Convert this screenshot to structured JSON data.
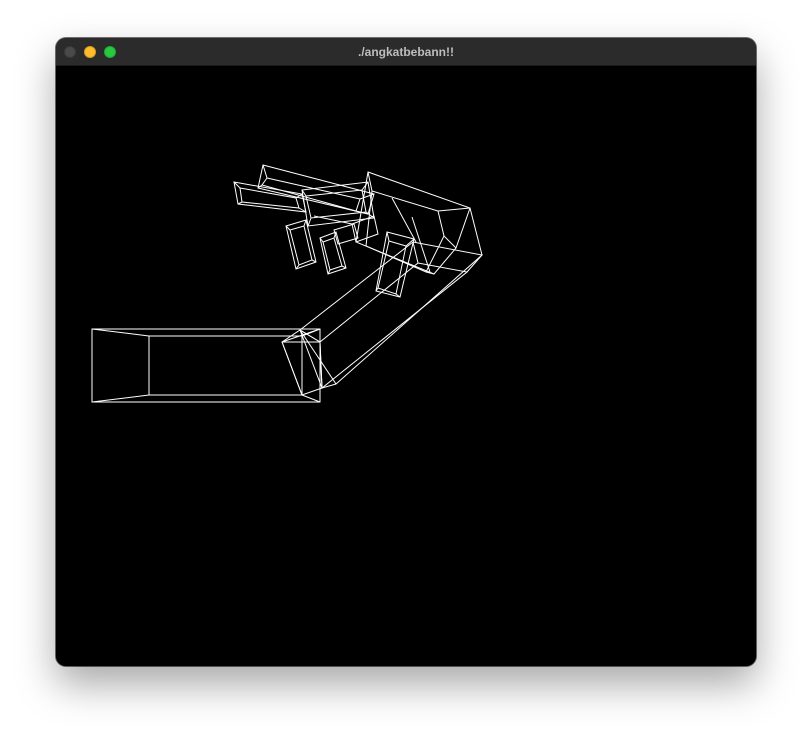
{
  "window": {
    "title": "./angkatbebann!!",
    "background_color": "#000000",
    "wireframe_color": "#ffffff",
    "titlebar_color": "#2b2b2b"
  },
  "controls": {
    "close": "close-button",
    "minimize": "minimize-button",
    "zoom": "zoom-button"
  }
}
